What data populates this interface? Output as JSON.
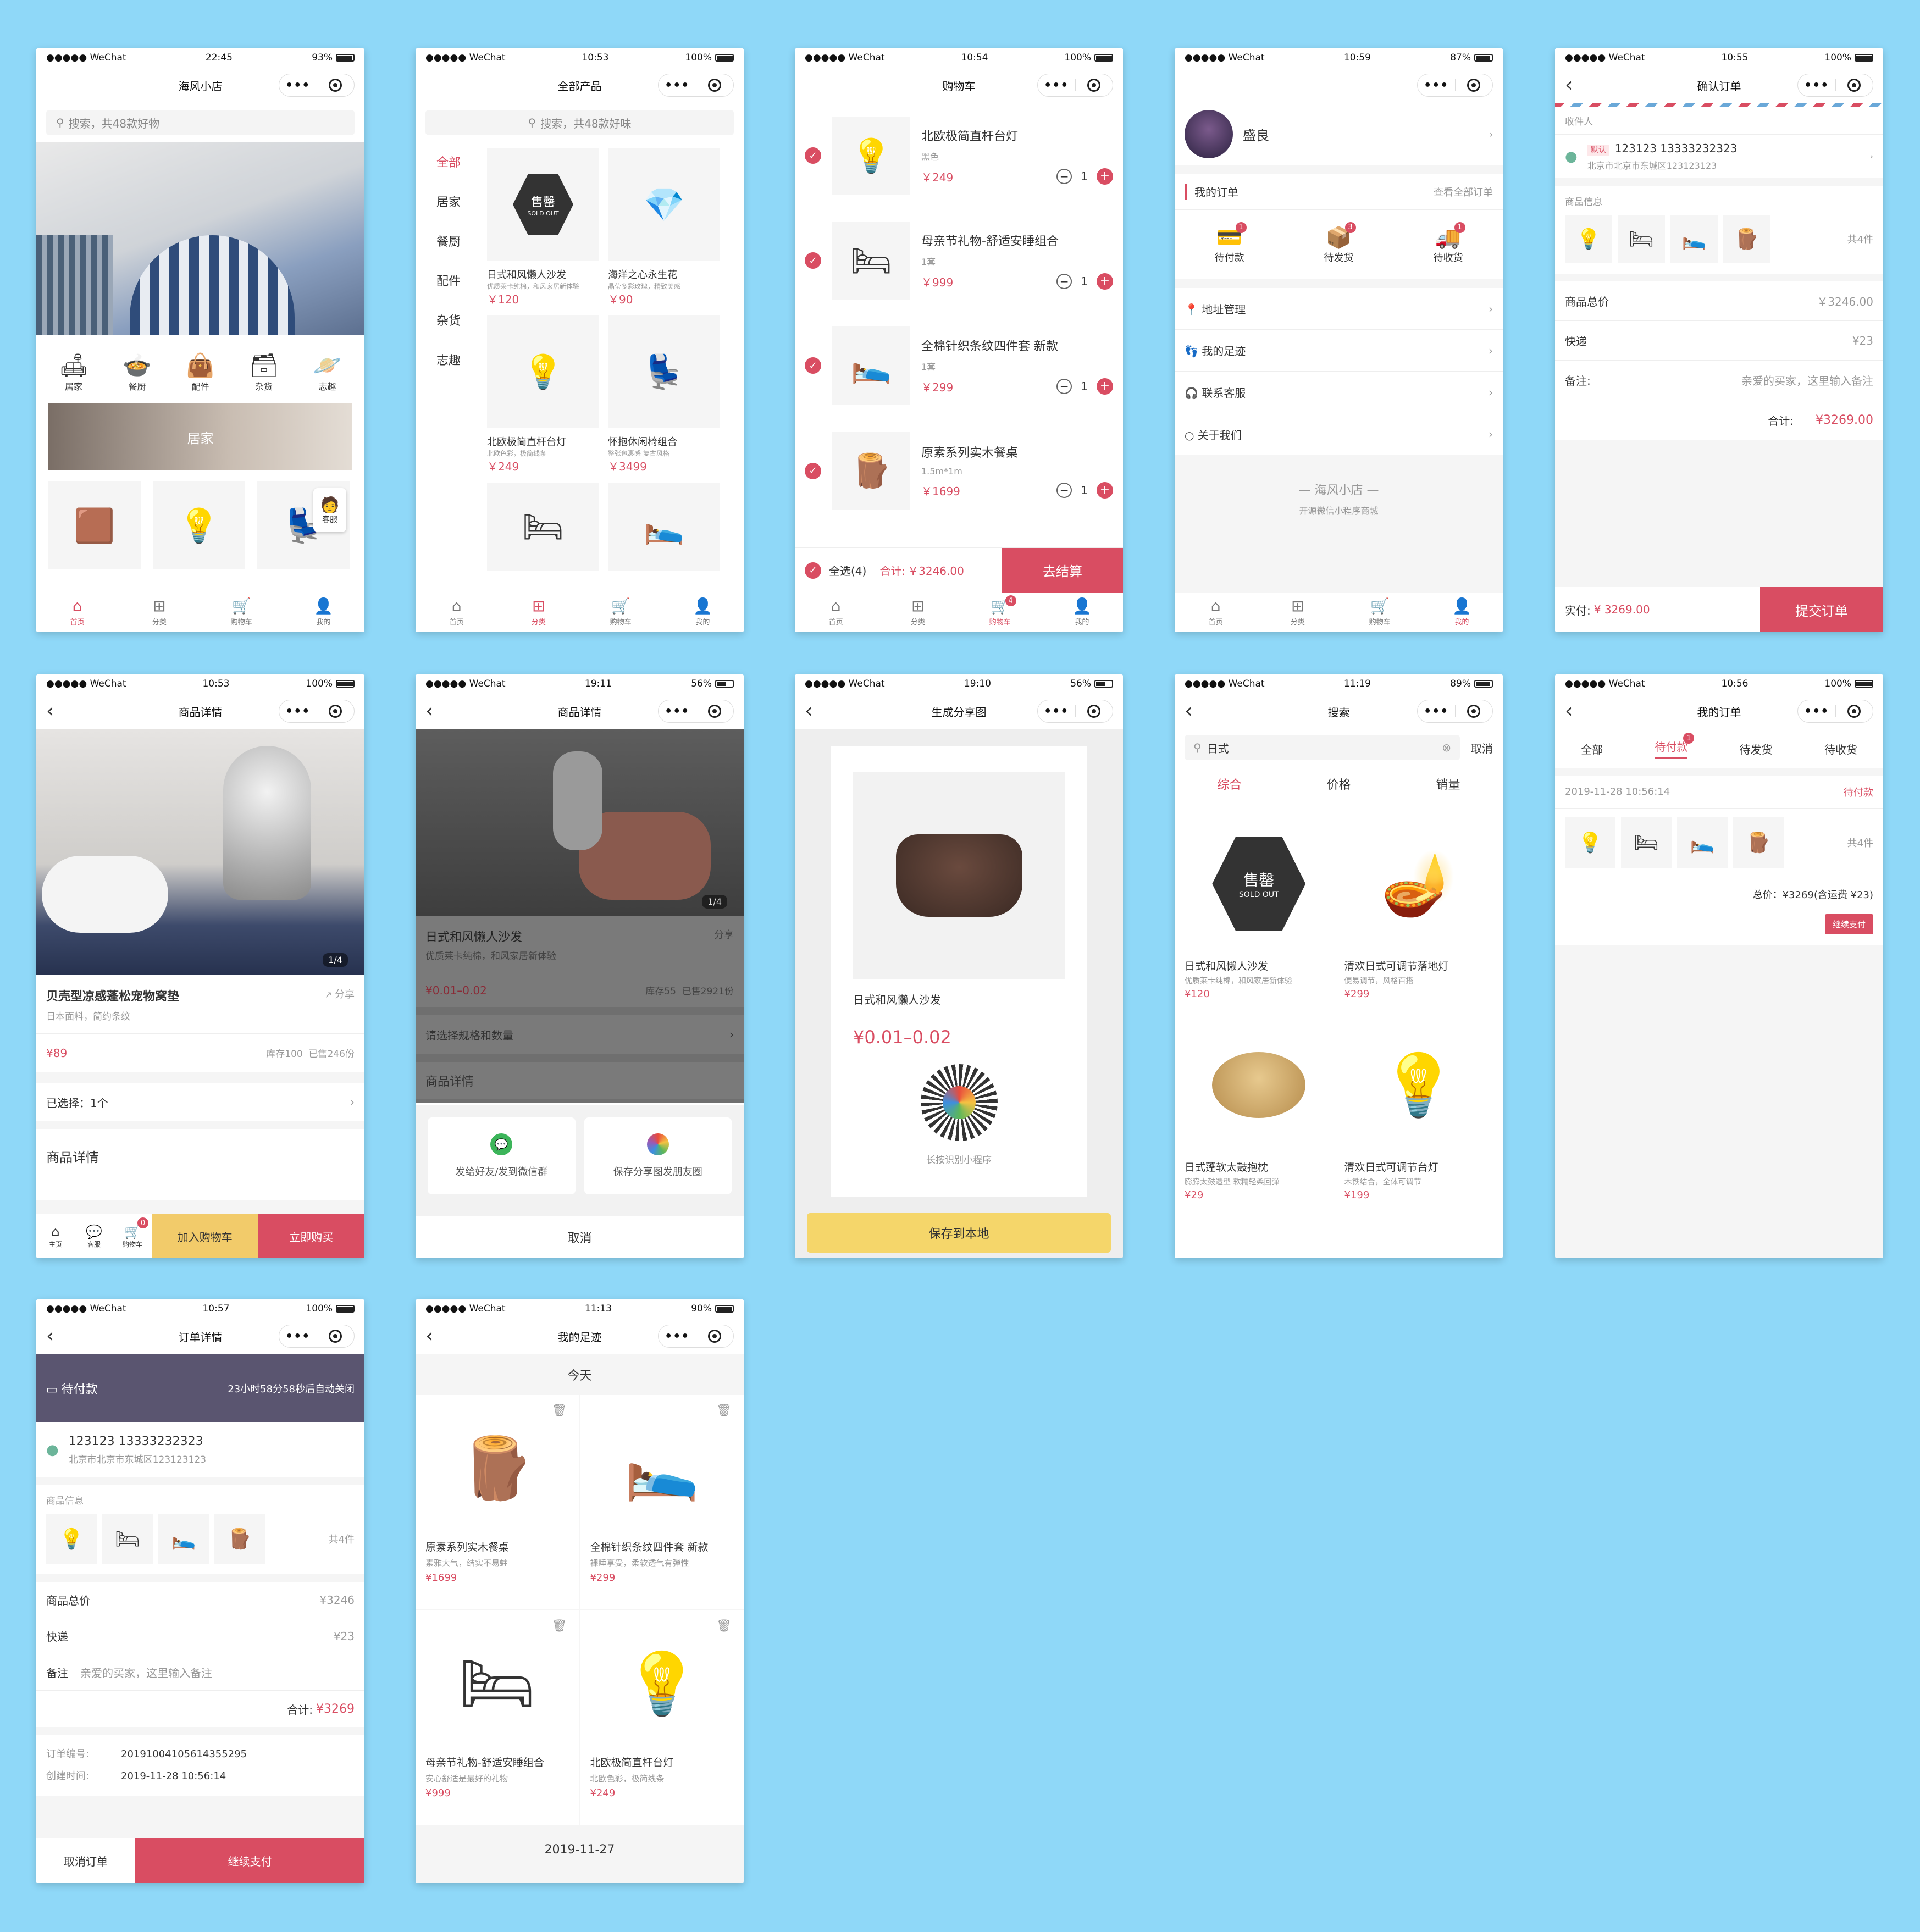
{
  "wechat": "●●●●● WeChat",
  "s1": {
    "time": "22:45",
    "batt": "93%",
    "title": "海风小店",
    "search": "搜索，共48款好物",
    "cats": [
      {
        "label": "居家",
        "icon": "🛋"
      },
      {
        "label": "餐厨",
        "icon": "🍲"
      },
      {
        "label": "配件",
        "icon": "👜"
      },
      {
        "label": "杂货",
        "icon": "🗃"
      },
      {
        "label": "志趣",
        "icon": "🪐"
      }
    ],
    "banner": "居家",
    "service": "客服"
  },
  "tabs": [
    "首页",
    "分类",
    "购物车",
    "我的"
  ],
  "s2": {
    "time": "10:53",
    "batt": "100%",
    "title": "全部产品",
    "search": "搜索，共48款好味",
    "side": [
      "全部",
      "居家",
      "餐厨",
      "配件",
      "杂货",
      "志趣"
    ],
    "items": [
      {
        "name": "日式和风懒人沙发",
        "desc": "优质莱卡纯棉，和风家居新体验",
        "price": "￥120",
        "icon": "🪑"
      },
      {
        "name": "海洋之心永生花",
        "desc": "晶莹多彩玫瑰，精致美感",
        "price": "￥90",
        "icon": "💎"
      },
      {
        "name": "北欧极简直杆台灯",
        "desc": "北欧色彩，极简线条",
        "price": "￥249",
        "icon": "💡"
      },
      {
        "name": "怀抱休闲椅组合",
        "desc": "整张包裹感 复古风格",
        "price": "￥3499",
        "icon": "💺"
      }
    ],
    "soldout": "售罄",
    "soldout_en": "SOLD OUT"
  },
  "s3": {
    "time": "10:54",
    "batt": "100%",
    "title": "购物车",
    "items": [
      {
        "name": "北欧极简直杆台灯",
        "spec": "黑色",
        "price": "￥249",
        "qty": "1",
        "icon": "💡"
      },
      {
        "name": "母亲节礼物-舒适安睡组合",
        "spec": "1套",
        "price": "￥999",
        "qty": "1",
        "icon": "🛏"
      },
      {
        "name": "全棉针织条纹四件套 新款",
        "spec": "1套",
        "price": "￥299",
        "qty": "1",
        "icon": "🛌"
      },
      {
        "name": "原素系列实木餐桌",
        "spec": "1.5m*1m",
        "price": "￥1699",
        "qty": "1",
        "icon": "🪵"
      }
    ],
    "all": "全选(4)",
    "total_label": "合计:",
    "total": "￥3246.00",
    "checkout": "去结算",
    "cart_badge": "4"
  },
  "s4": {
    "time": "10:59",
    "batt": "87%",
    "name": "盛良",
    "orders": "我的订单",
    "all_orders": "查看全部订单",
    "states": [
      {
        "label": "待付款",
        "badge": "1",
        "icon": "💳"
      },
      {
        "label": "待发货",
        "badge": "3",
        "icon": "📦"
      },
      {
        "label": "待收货",
        "badge": "1",
        "icon": "🚚"
      }
    ],
    "menu": [
      {
        "label": "地址管理",
        "icon": "📍"
      },
      {
        "label": "我的足迹",
        "icon": "👣"
      },
      {
        "label": "联系客服",
        "icon": "🎧"
      },
      {
        "label": "关于我们",
        "icon": "○"
      }
    ],
    "footer": "— 海风小店 —",
    "footer_sub": "开源微信小程序商城"
  },
  "s5": {
    "time": "10:55",
    "batt": "100%",
    "title": "确认订单",
    "recv": "收件人",
    "default": "默认",
    "phone": "123123 13333232323",
    "addr": "北京市北京市东城区123123123",
    "info": "商品信息",
    "count": "共4件",
    "rows": [
      {
        "k": "商品总价",
        "v": "￥3246.00"
      },
      {
        "k": "快递",
        "v": "¥23"
      },
      {
        "k": "备注:",
        "v": "亲爱的买家，这里输入备注"
      }
    ],
    "total_label": "合计:",
    "total": "¥3269.00",
    "pay_label": "实付:",
    "pay": "¥ 3269.00",
    "submit": "提交订单"
  },
  "s6": {
    "time": "10:53",
    "batt": "100%",
    "title": "商品详情",
    "page": "1/4",
    "name": "贝壳型凉感蓬松宠物窝垫",
    "sub": "日本面料，简约条纹",
    "share": "分享",
    "price": "¥89",
    "stock": "库存100",
    "sold": "已售246份",
    "chosen": "已选择：1个",
    "detail": "商品详情",
    "nav": [
      "主页",
      "客服",
      "购物车"
    ],
    "cart_badge": "0",
    "add": "加入购物车",
    "buy": "立即购买"
  },
  "s7": {
    "time": "19:11",
    "batt": "56%",
    "title": "商品详情",
    "page": "1/4",
    "name": "日式和风懒人沙发",
    "sub": "优质莱卡纯棉，和风家居新体验",
    "share": "分享",
    "price": "¥0.01–0.02",
    "stock": "库存55",
    "sold": "已售2921份",
    "spec": "请选择规格和数量",
    "detail": "商品详情",
    "opt1": "发给好友/发到微信群",
    "opt2": "保存分享图发朋友圈",
    "cancel": "取消"
  },
  "s8": {
    "time": "19:10",
    "batt": "56%",
    "title": "生成分享图",
    "name": "日式和风懒人沙发",
    "price": "¥0.01–0.02",
    "qr": "长按识别小程序",
    "save": "保存到本地"
  },
  "s9": {
    "time": "11:19",
    "batt": "89%",
    "title": "搜索",
    "query": "日式",
    "cancel": "取消",
    "sorts": [
      "综合",
      "价格",
      "销量"
    ],
    "items": [
      {
        "name": "日式和风懒人沙发",
        "desc": "优质莱卡纯棉，和风家居新体验",
        "price": "¥120",
        "icon": "🪑"
      },
      {
        "name": "清欢日式可调节落地灯",
        "desc": "便易调节，风格百搭",
        "price": "¥299",
        "icon": "🪔"
      },
      {
        "name": "日式蓬软太鼓抱枕",
        "desc": "膨膨太鼓造型 软糯轻柔回弹",
        "price": "¥29",
        "icon": "🟤"
      },
      {
        "name": "清欢日式可调节台灯",
        "desc": "木铁结合，全体可调节",
        "price": "¥199",
        "icon": "💡"
      }
    ]
  },
  "s10": {
    "time": "10:56",
    "batt": "100%",
    "title": "我的订单",
    "tabs": [
      "全部",
      "待付款",
      "待发货",
      "待收货"
    ],
    "badge": "1",
    "date": "2019-11-28 10:56:14",
    "status": "待付款",
    "count": "共4件",
    "total": "总价：¥3269(含运费 ¥23)",
    "pay": "继续支付"
  },
  "s11": {
    "time": "10:57",
    "batt": "100%",
    "title": "订单详情",
    "state": "待付款",
    "timer": "23小时58分58秒后自动关闭",
    "phone": "123123 13333232323",
    "addr": "北京市北京市东城区123123123",
    "info": "商品信息",
    "count": "共4件",
    "rows": [
      {
        "k": "商品总价",
        "v": "¥3246"
      },
      {
        "k": "快递",
        "v": "¥23"
      }
    ],
    "note_k": "备注",
    "note_v": "亲爱的买家，这里输入备注",
    "total_label": "合计:",
    "total": "¥3269",
    "no_k": "订单编号:",
    "no_v": "20191004105614355295",
    "ct_k": "创建时间:",
    "ct_v": "2019-11-28 10:56:14",
    "cancel": "取消订单",
    "pay": "继续支付"
  },
  "s12": {
    "time": "11:13",
    "batt": "90%",
    "title": "我的足迹",
    "today": "今天",
    "date": "2019-11-27",
    "items": [
      {
        "name": "原素系列实木餐桌",
        "desc": "素雅大气，结实不易蛀",
        "price": "¥1699",
        "icon": "🪵"
      },
      {
        "name": "全棉针织条纹四件套 新款",
        "desc": "裸睡享受，柔软透气有弹性",
        "price": "¥299",
        "icon": "🛌"
      },
      {
        "name": "母亲节礼物-舒适安睡组合",
        "desc": "安心舒适是最好的礼物",
        "price": "¥999",
        "icon": "🛏"
      },
      {
        "name": "北欧极简直杆台灯",
        "desc": "北欧色彩，极简线条",
        "price": "¥249",
        "icon": "💡"
      }
    ]
  },
  "colors": {
    "bg": "#8fd8f8",
    "accent": "#d94d62",
    "dark_band": "#5a5570",
    "yellow": "#f5d66a"
  }
}
